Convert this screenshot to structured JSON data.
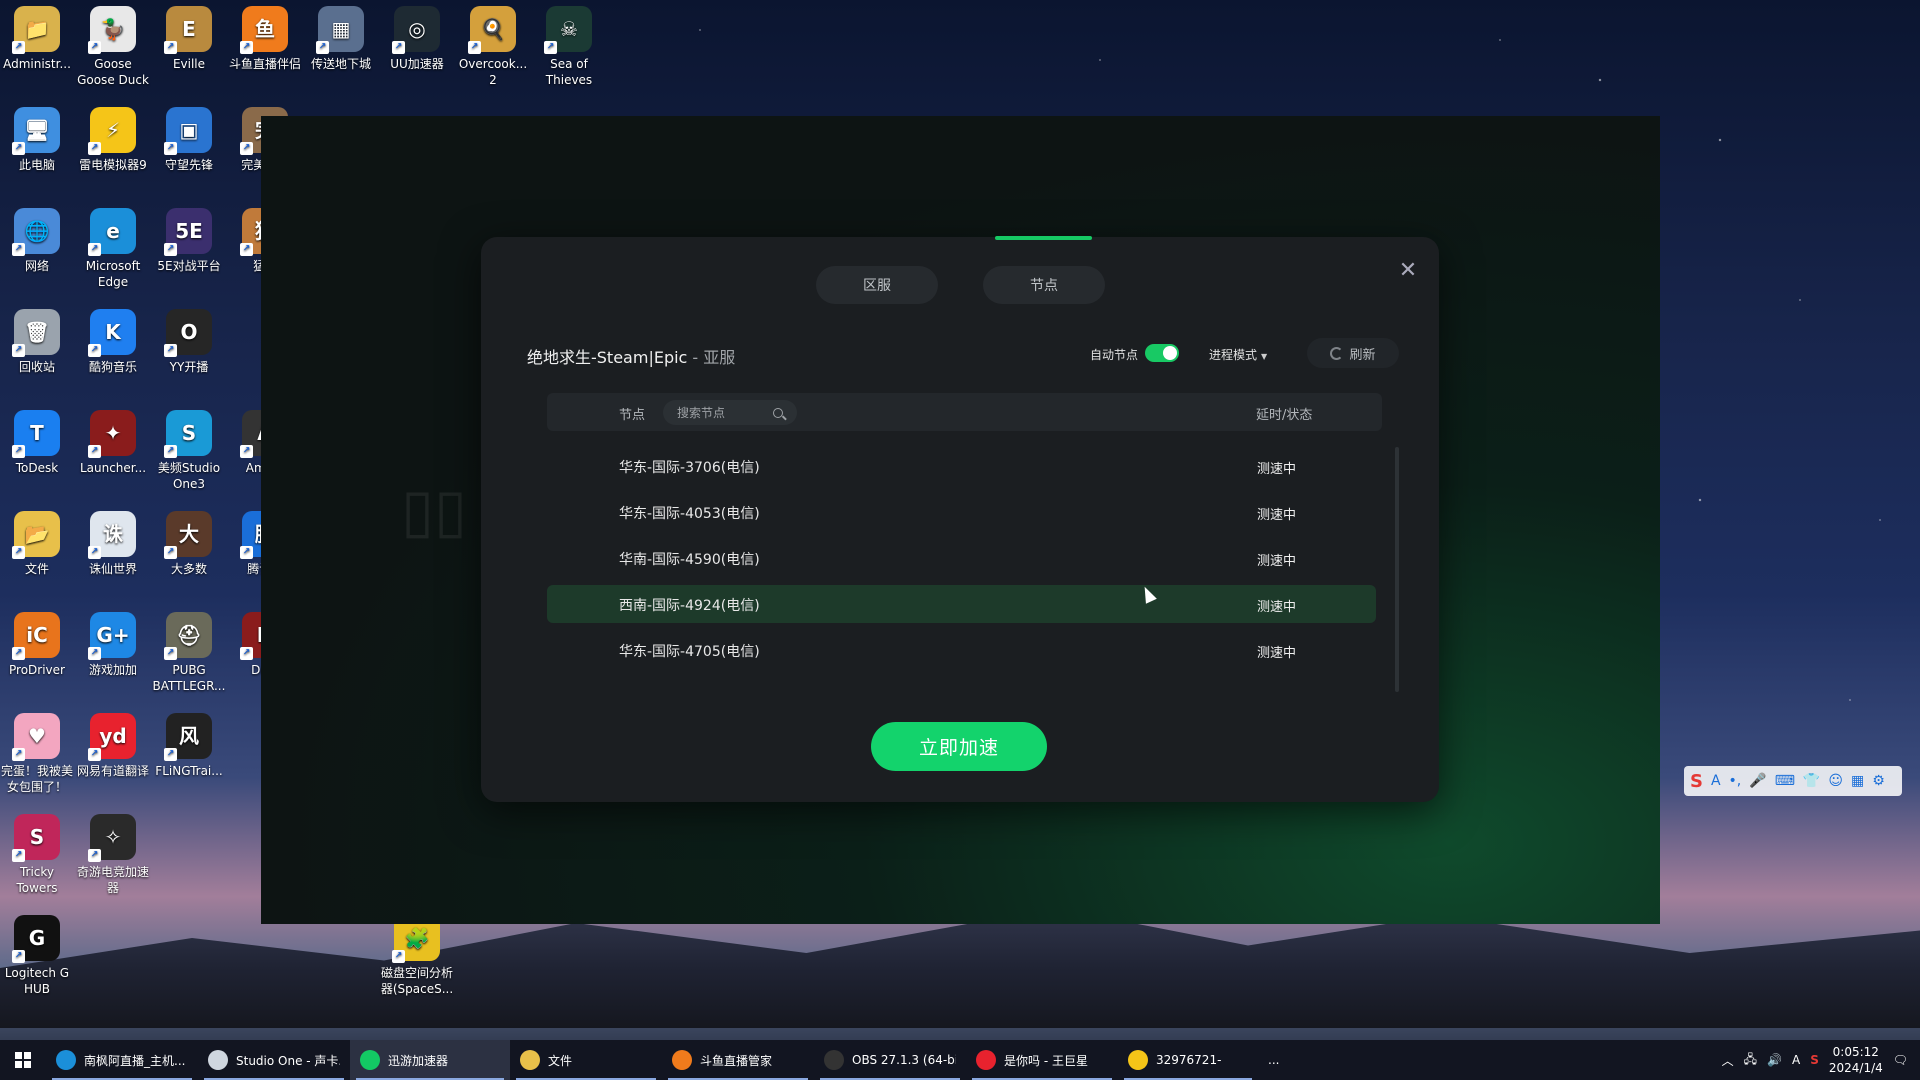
{
  "desktop_icons": [
    {
      "label": "Administr...",
      "color": "#d9b24c",
      "glyph": "📁"
    },
    {
      "label": "Goose Goose Duck",
      "color": "#e8e8e8",
      "glyph": "🦆"
    },
    {
      "label": "Eville",
      "color": "#b98a3e",
      "glyph": "E"
    },
    {
      "label": "斗鱼直播伴侣",
      "color": "#f07b1c",
      "glyph": "鱼"
    },
    {
      "label": "传送地下城",
      "color": "#5a6f8f",
      "glyph": "▦"
    },
    {
      "label": "UU加速器",
      "color": "#1e2a33",
      "glyph": "◎"
    },
    {
      "label": "Overcook... 2",
      "color": "#d4a03c",
      "glyph": "🍳"
    },
    {
      "label": "Sea of Thieves",
      "color": "#1b3a34",
      "glyph": "☠"
    },
    {
      "label": "此电脑",
      "color": "#3f8fe0",
      "glyph": "🖥"
    },
    {
      "label": "雷电模拟器9",
      "color": "#f5c518",
      "glyph": "⚡"
    },
    {
      "label": "守望先锋",
      "color": "#2a74d0",
      "glyph": "▣"
    },
    {
      "label": "完美世...",
      "color": "#8a6a4a",
      "glyph": "完"
    },
    {
      "label": "网络",
      "color": "#4a8ad8",
      "glyph": "🌐"
    },
    {
      "label": "Microsoft Edge",
      "color": "#1b8fd9",
      "glyph": "e"
    },
    {
      "label": "5E对战平台",
      "color": "#3b2f6e",
      "glyph": "5E"
    },
    {
      "label": "猛...",
      "color": "#c07a3a",
      "glyph": "猛"
    },
    {
      "label": "回收站",
      "color": "#9aa3ad",
      "glyph": "🗑"
    },
    {
      "label": "酷狗音乐",
      "color": "#1f7ff0",
      "glyph": "K"
    },
    {
      "label": "YY开播",
      "color": "#262626",
      "glyph": "O"
    },
    {
      "label": "ToDesk",
      "color": "#1a7ff0",
      "glyph": "T"
    },
    {
      "label": "Launcher...",
      "color": "#8a1c1c",
      "glyph": "✦"
    },
    {
      "label": "美频Studio One3",
      "color": "#1a9ad6",
      "glyph": "S"
    },
    {
      "label": "Amo...",
      "color": "#333",
      "glyph": "A"
    },
    {
      "label": "文件",
      "color": "#e8c04a",
      "glyph": "📂"
    },
    {
      "label": "诛仙世界",
      "color": "#dfe6ee",
      "glyph": "诛"
    },
    {
      "label": "大多数",
      "color": "#5a3a2a",
      "glyph": "大"
    },
    {
      "label": "腾讯...",
      "color": "#1a6ed8",
      "glyph": "腾"
    },
    {
      "label": "ProDriver",
      "color": "#e8741c",
      "glyph": "iC"
    },
    {
      "label": "游戏加加",
      "color": "#1e88e5",
      "glyph": "G+"
    },
    {
      "label": "PUBG BATTLEGR...",
      "color": "#6a6a5a",
      "glyph": "⛑"
    },
    {
      "label": "Do...",
      "color": "#8a1c1c",
      "glyph": "D"
    },
    {
      "label": "完蛋！我被美女包围了！",
      "color": "#f3a6c0",
      "glyph": "♥"
    },
    {
      "label": "网易有道翻译",
      "color": "#e8222e",
      "glyph": "yd"
    },
    {
      "label": "FLiNGTrai...",
      "color": "#222",
      "glyph": "风"
    },
    {
      "label": "Tricky Towers",
      "color": "#c0265a",
      "glyph": "S"
    },
    {
      "label": "奇游电竞加速器",
      "color": "#2a2a2a",
      "glyph": "✧"
    },
    {
      "label": "Logitech G HUB",
      "color": "#111",
      "glyph": "G"
    },
    {
      "label": "磁盘空间分析器(SpaceS...",
      "color": "#e8c020",
      "glyph": "🧩"
    }
  ],
  "dialog": {
    "tabs": [
      "区服",
      "节点"
    ],
    "game_name": "绝地求生-Steam|Epic",
    "separator": " - ",
    "region": "亚服",
    "auto_node_label": "自动节点",
    "auto_node_on": true,
    "mode_label": "进程模式",
    "refresh_label": "刷新",
    "column_node": "节点",
    "search_placeholder": "搜索节点",
    "column_latency": "延时/状态",
    "nodes": [
      {
        "name": "华东-国际-3706(电信)",
        "status": "测速中",
        "selected": false
      },
      {
        "name": "华东-国际-4053(电信)",
        "status": "测速中",
        "selected": false
      },
      {
        "name": "华南-国际-4590(电信)",
        "status": "测速中",
        "selected": false
      },
      {
        "name": "西南-国际-4924(电信)",
        "status": "测速中",
        "selected": true
      },
      {
        "name": "华东-国际-4705(电信)",
        "status": "测速中",
        "selected": false
      }
    ],
    "cta_label": "立即加速",
    "accent": "#13d36c"
  },
  "taskbar": {
    "items": [
      {
        "label": "南枫阿直播_主机...",
        "color": "#1b8fd9"
      },
      {
        "label": "Studio One - 声卡...",
        "color": "#cfd6df"
      },
      {
        "label": "迅游加速器",
        "color": "#13c964"
      },
      {
        "label": "文件",
        "color": "#e8c04a"
      },
      {
        "label": "斗鱼直播管家",
        "color": "#f07b1c"
      },
      {
        "label": "OBS 27.1.3 (64-bi...",
        "color": "#333"
      },
      {
        "label": "是你吗 - 王巨星",
        "color": "#e8222e"
      },
      {
        "label": "32976721-",
        "color": "#f5c518"
      }
    ],
    "more": "...",
    "time": "0:05:12",
    "date": "2024/1/4"
  }
}
